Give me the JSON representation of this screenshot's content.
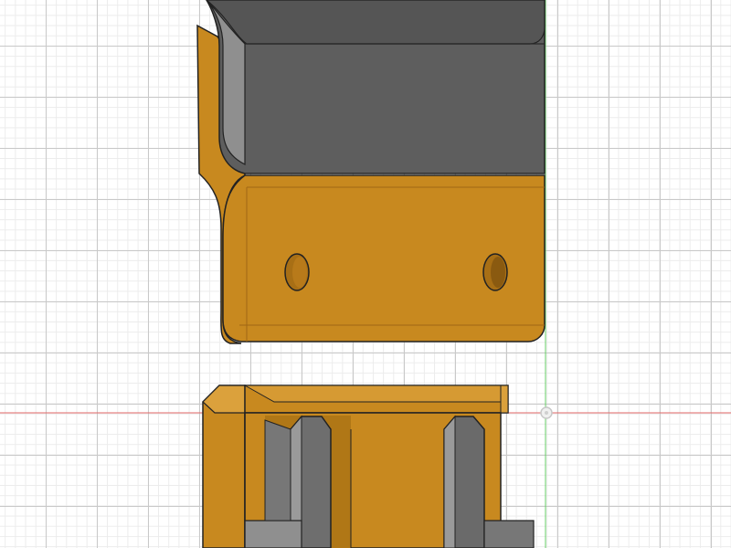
{
  "viewport": {
    "name": "cad-3d-viewport"
  },
  "colors": {
    "body_orange": "#c8891f",
    "body_orange_dark": "#a86f15",
    "body_orange_light": "#dba13c",
    "gray_face": "#6a6a6a",
    "gray_top": "#5c5c5c",
    "gray_light": "#8a8a8a",
    "axis_red": "#e05050",
    "axis_green": "#50c050"
  },
  "objects": {
    "upper_part": "bracket-top-view",
    "lower_part": "bracket-side-view"
  },
  "gizmo": {
    "icon": "origin-point-icon"
  }
}
